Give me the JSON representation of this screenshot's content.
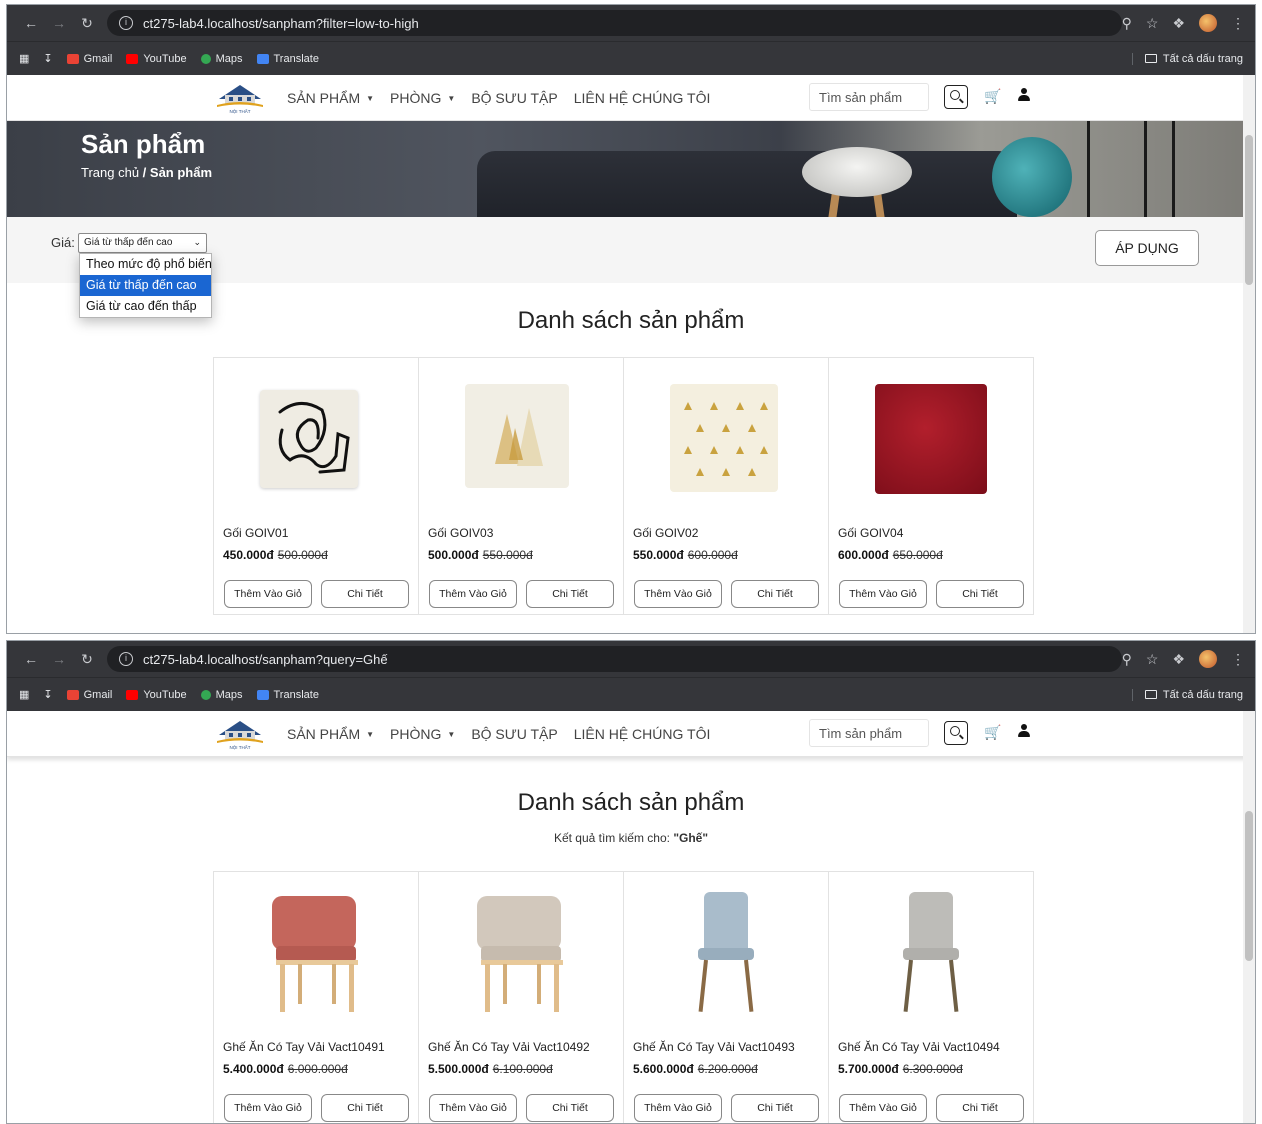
{
  "screens": [
    {
      "url": "ct275-lab4.localhost/sanpham?filter=low-to-high",
      "bookmarks": [
        "Gmail",
        "YouTube",
        "Maps",
        "Translate"
      ],
      "bookmarks_folder": "Tất cả dấu trang",
      "nav": [
        "SẢN PHẨM",
        "PHÒNG",
        "BỘ SƯU TẬP",
        "LIÊN HỆ CHÚNG TÔI"
      ],
      "search_placeholder": "Tìm sản phẩm",
      "banner_title": "Sản phẩm",
      "breadcrumb_home": "Trang chủ",
      "breadcrumb_sep": " / ",
      "breadcrumb_current": "Sản phẩm",
      "filter_label": "Giá:",
      "filter_selected": "Giá từ thấp đến cao",
      "filter_options": [
        "Theo mức độ phổ biến",
        "Giá từ thấp đến cao",
        "Giá từ cao đến thấp"
      ],
      "apply_label": "ÁP DỤNG",
      "heading": "Danh sách sản phẩm",
      "products": [
        {
          "name": "Gối GOIV01",
          "price": "450.000đ",
          "old_price": "500.000đ"
        },
        {
          "name": "Gối GOIV03",
          "price": "500.000đ",
          "old_price": "550.000đ"
        },
        {
          "name": "Gối GOIV02",
          "price": "550.000đ",
          "old_price": "600.000đ"
        },
        {
          "name": "Gối GOIV04",
          "price": "600.000đ",
          "old_price": "650.000đ"
        }
      ]
    },
    {
      "url": "ct275-lab4.localhost/sanpham?query=Ghế",
      "heading": "Danh sách sản phẩm",
      "search_note_prefix": "Kết quả tìm kiếm cho: ",
      "search_query": "\"Ghế\"",
      "products": [
        {
          "name": "Ghế Ăn Có Tay Vải Vact10491",
          "price": "5.400.000đ",
          "old_price": "6.000.000đ"
        },
        {
          "name": "Ghế Ăn Có Tay Vải Vact10492",
          "price": "5.500.000đ",
          "old_price": "6.100.000đ"
        },
        {
          "name": "Ghế Ăn Có Tay Vải Vact10493",
          "price": "5.600.000đ",
          "old_price": "6.200.000đ"
        },
        {
          "name": "Ghế Ăn Có Tay Vải Vact10494",
          "price": "5.700.000đ",
          "old_price": "6.300.000đ"
        }
      ]
    }
  ],
  "buttons": {
    "add_to_cart": "Thêm Vào Giỏ",
    "details": "Chi Tiết"
  },
  "colors": {
    "dropdown_selected": "#1a66d2",
    "chrome_dark": "#35363a"
  }
}
